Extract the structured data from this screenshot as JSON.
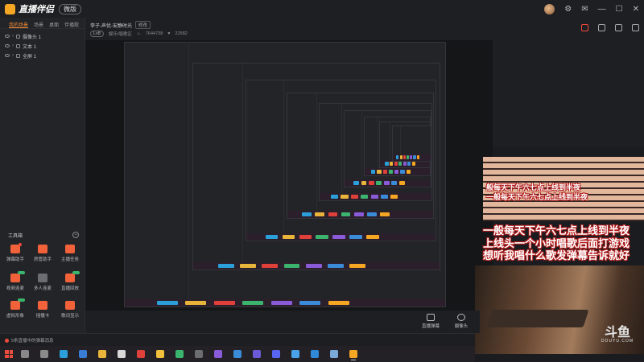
{
  "app": {
    "name": "直播伴侣",
    "version_badge": "微版"
  },
  "window_controls": {
    "avatar": "avatar",
    "icons": [
      "settings-icon",
      "mail-icon",
      "minimize-icon",
      "maximize-icon",
      "close-icon"
    ]
  },
  "scene_tabs": [
    {
      "label": "我的场景",
      "active": true
    },
    {
      "label": "场景",
      "active": false
    },
    {
      "label": "桌面",
      "active": false
    },
    {
      "label": "伴播歌",
      "active": false
    }
  ],
  "sources": [
    {
      "label": "摄像头 1"
    },
    {
      "label": "文本 1"
    },
    {
      "label": "全屏 1"
    }
  ],
  "toolbox": {
    "title": "工具箱",
    "tools": [
      {
        "label": "弹幕助手",
        "icon": "danmaku-icon",
        "color": "#f2623a",
        "badge": "dot"
      },
      {
        "label": "房管助手",
        "icon": "admin-icon",
        "color": "#f2623a",
        "badge": ""
      },
      {
        "label": "主播任务",
        "icon": "task-icon",
        "color": "#f2623a",
        "badge": ""
      },
      {
        "label": "视频连麦",
        "icon": "video-link-icon",
        "color": "#f2623a",
        "badge": "tag"
      },
      {
        "label": "多人连麦",
        "icon": "multi-link-icon",
        "color": "#6b6d72",
        "badge": ""
      },
      {
        "label": "直播回放",
        "icon": "replay-icon",
        "color": "#f2623a",
        "badge": "tag"
      },
      {
        "label": "虚拟形象",
        "icon": "avatar-icon",
        "color": "#f2623a",
        "badge": "tag"
      },
      {
        "label": "插播卡",
        "icon": "card-icon",
        "color": "#f2623a",
        "badge": ""
      },
      {
        "label": "歌词显示",
        "icon": "lyrics-icon",
        "color": "#f2623a",
        "badge": ""
      }
    ]
  },
  "room": {
    "title": "李子-声优-安静时光",
    "edit_label": "修改",
    "level": "Lv8",
    "category": "娱乐/唱歌区",
    "hot": "7644738",
    "fans": "22582"
  },
  "overlay_text": {
    "line_repeat_a": "般每天下午六七点上线到半夜",
    "line_repeat_b": "一般每天下午六七点上线到半夜",
    "line1": "一般每天下午六七点上线到半夜",
    "line2": "上线头一个小时唱歌后面打游戏",
    "line3": "想听我唱什么歌发弹幕告诉就好"
  },
  "stream_logo": {
    "main": "斗鱼",
    "sub": "DOUYU.COM"
  },
  "bottom_bar": {
    "buttons": [
      {
        "label": "直播弹幕",
        "icon": "danmaku-screen-icon"
      },
      {
        "label": "摄像头",
        "icon": "camera-icon"
      }
    ]
  },
  "status_bar": {
    "text": "5条直播中的弹幕消息"
  },
  "taskbar": {
    "apps": [
      {
        "icon": "search-icon",
        "color": "#888888"
      },
      {
        "icon": "task-view-icon",
        "color": "#8a8a8a"
      },
      {
        "icon": "edge-icon",
        "color": "#2b9fd9"
      },
      {
        "icon": "store-icon",
        "color": "#3a7bd5"
      },
      {
        "icon": "explorer-icon",
        "color": "#e8b43a"
      },
      {
        "icon": "chrome-icon",
        "color": "#d9d9d9"
      },
      {
        "icon": "netease-icon",
        "color": "#e0403a"
      },
      {
        "icon": "qq-music-icon",
        "color": "#f0c23b"
      },
      {
        "icon": "wechat-icon",
        "color": "#3bb46e"
      },
      {
        "icon": "video-icon",
        "color": "#6b6d72"
      },
      {
        "icon": "premiere-icon",
        "color": "#8a5bd8"
      },
      {
        "icon": "photoshop-icon",
        "color": "#3a8bd8"
      },
      {
        "icon": "after-effects-icon",
        "color": "#6a5ad8"
      },
      {
        "icon": "discord-icon",
        "color": "#5865f2"
      },
      {
        "icon": "app-icon",
        "color": "#4aa3e8"
      },
      {
        "icon": "app2-icon",
        "color": "#2f8ad8"
      },
      {
        "icon": "app3-icon",
        "color": "#7aa8d8"
      },
      {
        "icon": "live-companion-icon",
        "color": "#f5a623"
      }
    ]
  },
  "colors": {
    "accent": "#f28c38",
    "danger": "#f24a3c"
  }
}
